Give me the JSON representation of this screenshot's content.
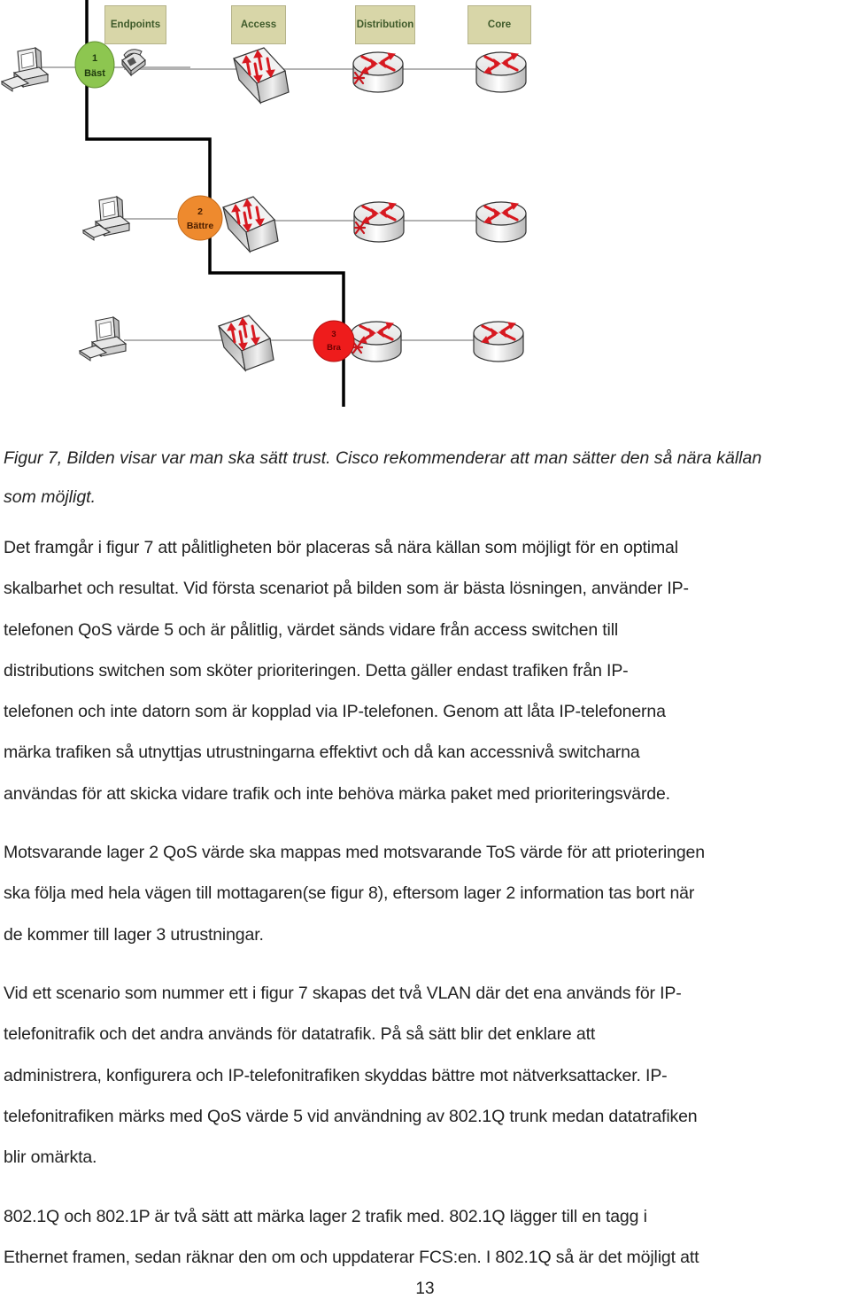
{
  "figure": {
    "column_headers": [
      "Endpoints",
      "Access",
      "Distribution",
      "Core"
    ],
    "trust_markers": [
      {
        "number": "1",
        "label": "Bäst",
        "color": "#8dc650"
      },
      {
        "number": "2",
        "label": "Bättre",
        "color": "#ee8a2e"
      },
      {
        "number": "3",
        "label": "Bra",
        "color": "#ee1c1c"
      }
    ],
    "device_icons": [
      "computer-icon",
      "ip-phone-icon",
      "switch-icon",
      "router-icon"
    ],
    "colors": {
      "header_fill": "#d8d6a8",
      "header_text": "#3e5a2a",
      "arrow_red": "#d71920",
      "trust_boundary": "#000000",
      "link_gray": "#9a9a9a"
    }
  },
  "caption": {
    "lines": [
      "Figur 7, Bilden visar var man ska sätt trust. Cisco rekommenderar att man sätter den så nära källan",
      "som möjligt."
    ]
  },
  "paragraphs": [
    {
      "lines": [
        "Det framgår i figur 7 att pålitligheten bör placeras så nära källan som möjligt för en optimal",
        "skalbarhet och resultat. Vid första scenariot på bilden som är bästa lösningen, använder IP-",
        "telefonen QoS värde 5 och är pålitlig, värdet sänds vidare från access switchen till",
        "distributions switchen som sköter prioriteringen. Detta gäller endast trafiken från IP-",
        "telefonen och inte datorn som är kopplad via IP-telefonen. Genom att låta IP-telefonerna",
        "märka trafiken så utnyttjas utrustningarna effektivt och då kan accessnivå switcharna",
        "användas för att skicka vidare trafik och inte behöva märka paket med prioriteringsvärde."
      ]
    },
    {
      "lines": [
        "Motsvarande lager 2 QoS värde ska mappas med motsvarande ToS värde för att prioteringen",
        "ska följa med hela vägen till mottagaren(se figur 8), eftersom lager 2 information tas bort när",
        "de kommer till lager 3 utrustningar."
      ]
    },
    {
      "lines": [
        "Vid ett scenario som nummer ett i figur 7 skapas det två VLAN där det ena används för IP-",
        "telefonitrafik och det andra används för datatrafik. På så sätt blir det enklare att",
        "administrera, konfigurera och IP-telefonitrafiken skyddas bättre mot nätverksattacker. IP-",
        "telefonitrafiken märks med QoS värde 5 vid användning av 802.1Q trunk medan datatrafiken",
        "blir omärkta."
      ]
    },
    {
      "lines": [
        "802.1Q och 802.1P är två sätt att märka lager 2 trafik med. 802.1Q lägger till en tagg i",
        "Ethernet framen, sedan räknar den om och uppdaterar FCS:en. I 802.1Q så är det möjligt att"
      ]
    }
  ],
  "page_number": "13"
}
